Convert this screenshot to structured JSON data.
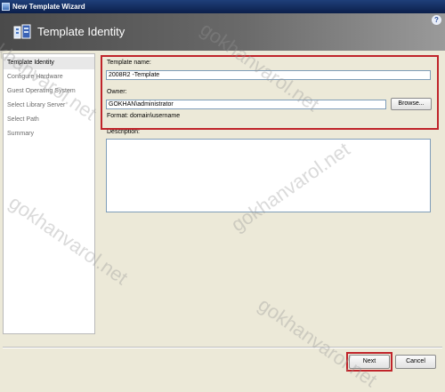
{
  "window": {
    "title": "New Template Wizard",
    "help_label": "?"
  },
  "header": {
    "title": "Template Identity"
  },
  "sidebar": {
    "items": [
      {
        "label": "Template Identity"
      },
      {
        "label": "Configure Hardware"
      },
      {
        "label": "Guest Operating System"
      },
      {
        "label": "Select Library Server"
      },
      {
        "label": "Select Path"
      },
      {
        "label": "Summary"
      }
    ]
  },
  "form": {
    "template_name_label": "Template name:",
    "template_name_value": "2008R2 -Template",
    "owner_label": "Owner:",
    "owner_value": "GOKHAN\\administrator",
    "browse_label": "Browse...",
    "format_hint": "Format: domain\\username",
    "description_label": "Description:",
    "description_value": ""
  },
  "footer": {
    "next_label": "Next",
    "cancel_label": "Cancel"
  },
  "watermark": {
    "text": "gokhanvarol.net"
  },
  "colors": {
    "highlight": "#c0242a",
    "title_bar": "#0b1f4a"
  }
}
